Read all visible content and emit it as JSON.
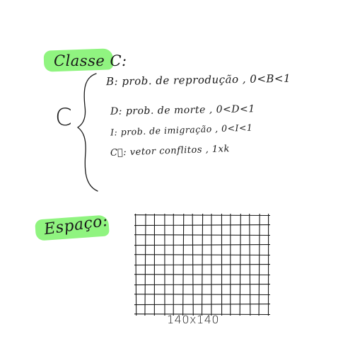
{
  "headings": {
    "classe": "Classe C:",
    "espaco": "Espaço:"
  },
  "definition": {
    "symbol": "C",
    "lines": [
      "B: prob. de reprodução , 0<B<1",
      "D: prob. de morte , 0<D<1",
      "I: prob. de imigração , 0<I<1",
      "C⃗: vetor conflitos , 1xk"
    ]
  },
  "grid": {
    "label": "140x140",
    "columns": 14,
    "rows": 10
  },
  "colors": {
    "highlight": "#7df26a",
    "ink": "#1a1a1a"
  }
}
